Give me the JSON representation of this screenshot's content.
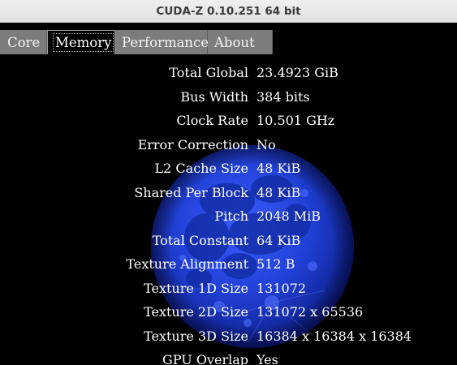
{
  "window": {
    "title": "CUDA-Z 0.10.251 64 bit"
  },
  "tabs": [
    {
      "label": "Core",
      "active": false
    },
    {
      "label": "Memory",
      "active": true
    },
    {
      "label": "Performance",
      "active": false
    },
    {
      "label": "About",
      "active": false
    }
  ],
  "memory": {
    "background_image": "blue-moon",
    "rows": [
      {
        "label": "Total Global",
        "value": "23.4923 GiB"
      },
      {
        "label": "Bus Width",
        "value": "384 bits"
      },
      {
        "label": "Clock Rate",
        "value": "10.501 GHz"
      },
      {
        "label": "Error Correction",
        "value": "No"
      },
      {
        "label": "L2 Cache Size",
        "value": "48 KiB"
      },
      {
        "label": "Shared Per Block",
        "value": "48 KiB"
      },
      {
        "label": "Pitch",
        "value": "2048 MiB"
      },
      {
        "label": "Total Constant",
        "value": "64 KiB"
      },
      {
        "label": "Texture Alignment",
        "value": "512 B"
      },
      {
        "label": "Texture 1D Size",
        "value": "131072"
      },
      {
        "label": "Texture 2D Size",
        "value": "131072 x 65536"
      },
      {
        "label": "Texture 3D Size",
        "value": "16384 x 16384 x 16384"
      },
      {
        "label": "GPU Overlap",
        "value": "Yes"
      }
    ]
  },
  "colors": {
    "background": "#000000",
    "tab_inactive": "#7c7c7c",
    "moon": "#1f3fd0",
    "text": "#ffffff"
  }
}
